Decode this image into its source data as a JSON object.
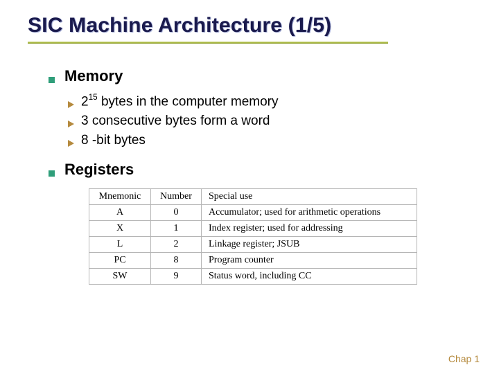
{
  "title": "SIC Machine Architecture (1/5)",
  "sections": [
    {
      "heading": "Memory",
      "items": [
        {
          "base": "2",
          "exp": "15",
          "rest": " bytes in the computer memory"
        },
        {
          "text": "3 consecutive bytes form a word"
        },
        {
          "text": "8 -bit bytes"
        }
      ]
    },
    {
      "heading": "Registers"
    }
  ],
  "chart_data": {
    "type": "table",
    "title": "Registers",
    "columns": [
      "Mnemonic",
      "Number",
      "Special use"
    ],
    "rows": [
      [
        "A",
        "0",
        "Accumulator; used for arithmetic operations"
      ],
      [
        "X",
        "1",
        "Index register; used for addressing"
      ],
      [
        "L",
        "2",
        "Linkage register; JSUB"
      ],
      [
        "PC",
        "8",
        "Program counter"
      ],
      [
        "SW",
        "9",
        "Status word, including CC"
      ]
    ]
  },
  "footer": "Chap 1"
}
